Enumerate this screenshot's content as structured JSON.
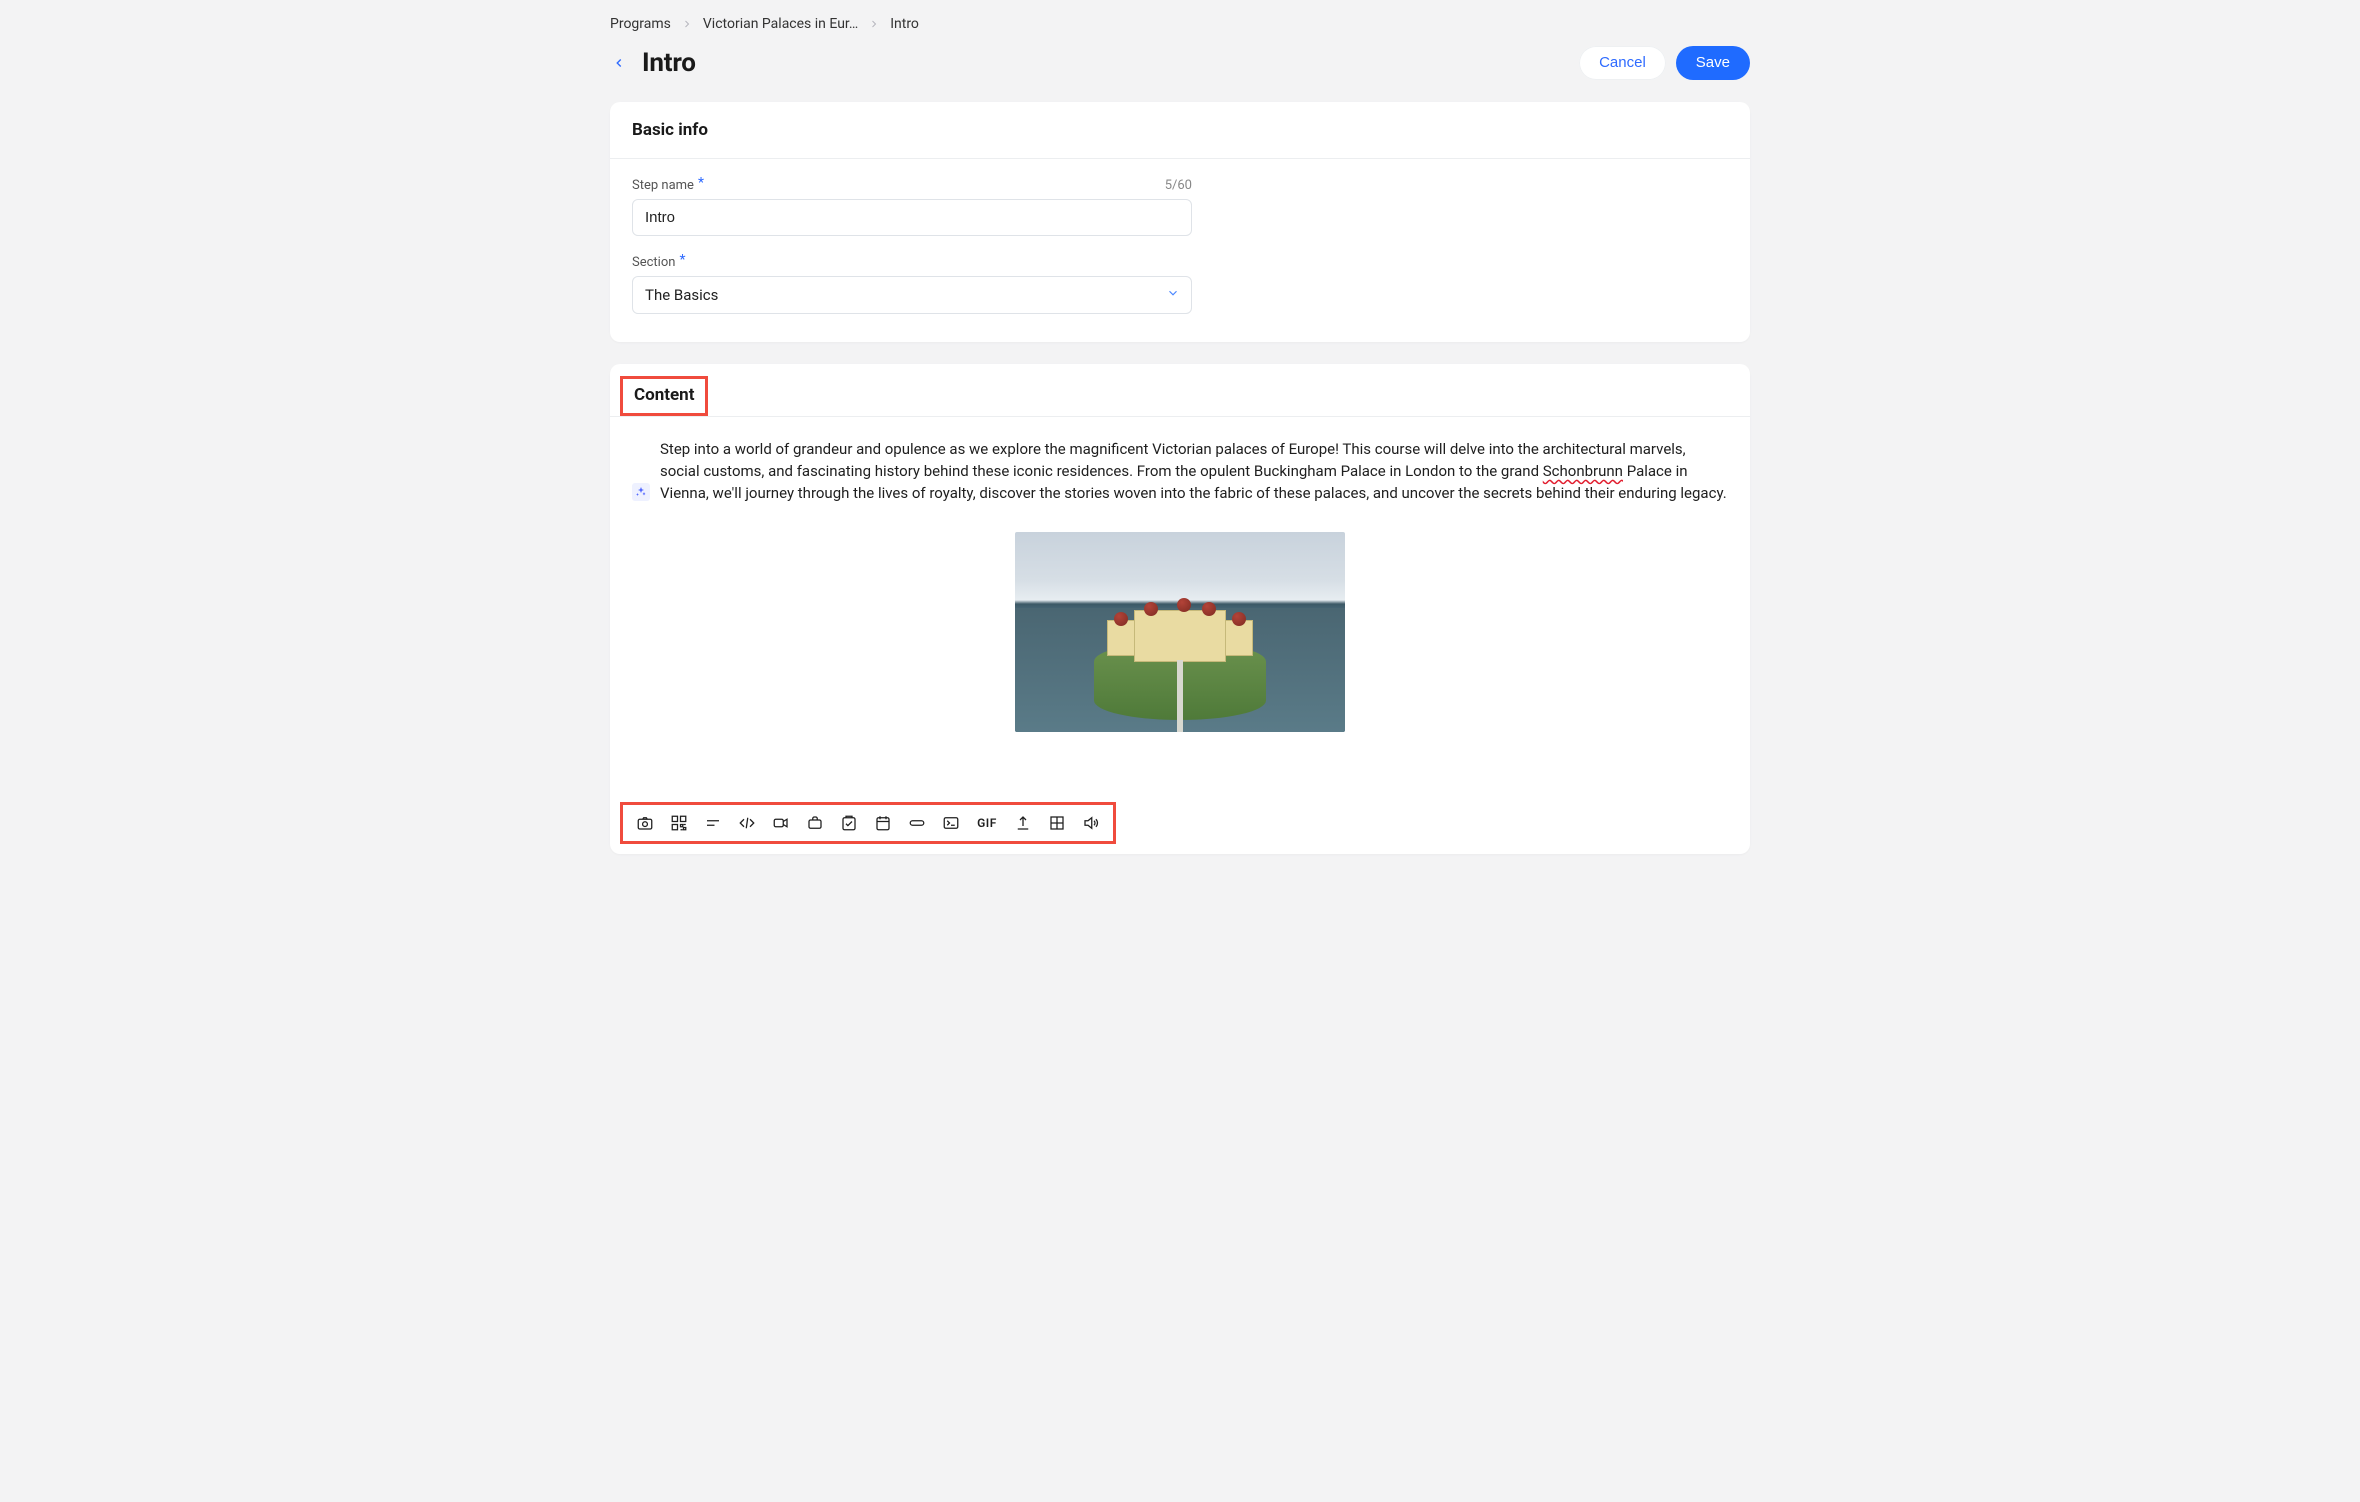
{
  "breadcrumb": {
    "items": [
      {
        "label": "Programs"
      },
      {
        "label": "Victorian Palaces in Eur…"
      },
      {
        "label": "Intro"
      }
    ]
  },
  "header": {
    "title": "Intro",
    "cancel_label": "Cancel",
    "save_label": "Save"
  },
  "basic_info": {
    "heading": "Basic info",
    "step_name": {
      "label": "Step name",
      "required_marker": "*",
      "value": "Intro",
      "counter": "5/60"
    },
    "section": {
      "label": "Section",
      "required_marker": "*",
      "value": "The Basics"
    }
  },
  "content": {
    "heading": "Content",
    "paragraph_pre": "Step into a world of grandeur and opulence as we explore the magnificent Victorian palaces of Europe! This course will delve into the architectural marvels, social customs, and fascinating history behind these iconic residences. From the opulent Buckingham Palace in London to the grand ",
    "spelled_word": "Schonbrunn",
    "paragraph_post": " Palace in Vienna, we'll journey through the lives of royalty, discover the stories woven into the fabric of these palaces, and uncover the secrets behind their enduring legacy.",
    "image_alt": "Aerial view of a baroque palace on a lake"
  },
  "toolbar": {
    "items": [
      "camera-icon",
      "qr-icon",
      "line-icon",
      "code-icon",
      "video-icon",
      "briefcase-icon",
      "checklist-icon",
      "calendar-icon",
      "link-icon",
      "terminal-icon",
      "gif-icon",
      "upload-icon",
      "grid-icon",
      "audio-icon"
    ],
    "gif_label": "GIF"
  },
  "colors": {
    "accent": "#1f6bff",
    "highlight": "#f04b3d"
  }
}
